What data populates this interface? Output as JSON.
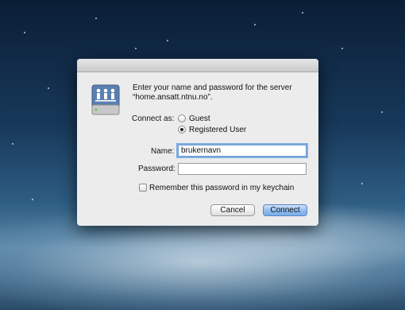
{
  "dialog": {
    "message": "Enter your name and password for the server “home.ansatt.ntnu.no”.",
    "connect_as_label": "Connect as:",
    "options": [
      {
        "label": "Guest",
        "selected": false
      },
      {
        "label": "Registered User",
        "selected": true
      }
    ],
    "name_label": "Name:",
    "name_value": "brukernavn",
    "password_label": "Password:",
    "password_value": "",
    "remember_label": "Remember this password in my keychain",
    "remember_checked": false,
    "cancel_label": "Cancel",
    "connect_label": "Connect"
  },
  "icons": {
    "server": "network-server-icon"
  },
  "colors": {
    "default_button": "#7aaeea",
    "focus_ring": "#7eaee4"
  }
}
